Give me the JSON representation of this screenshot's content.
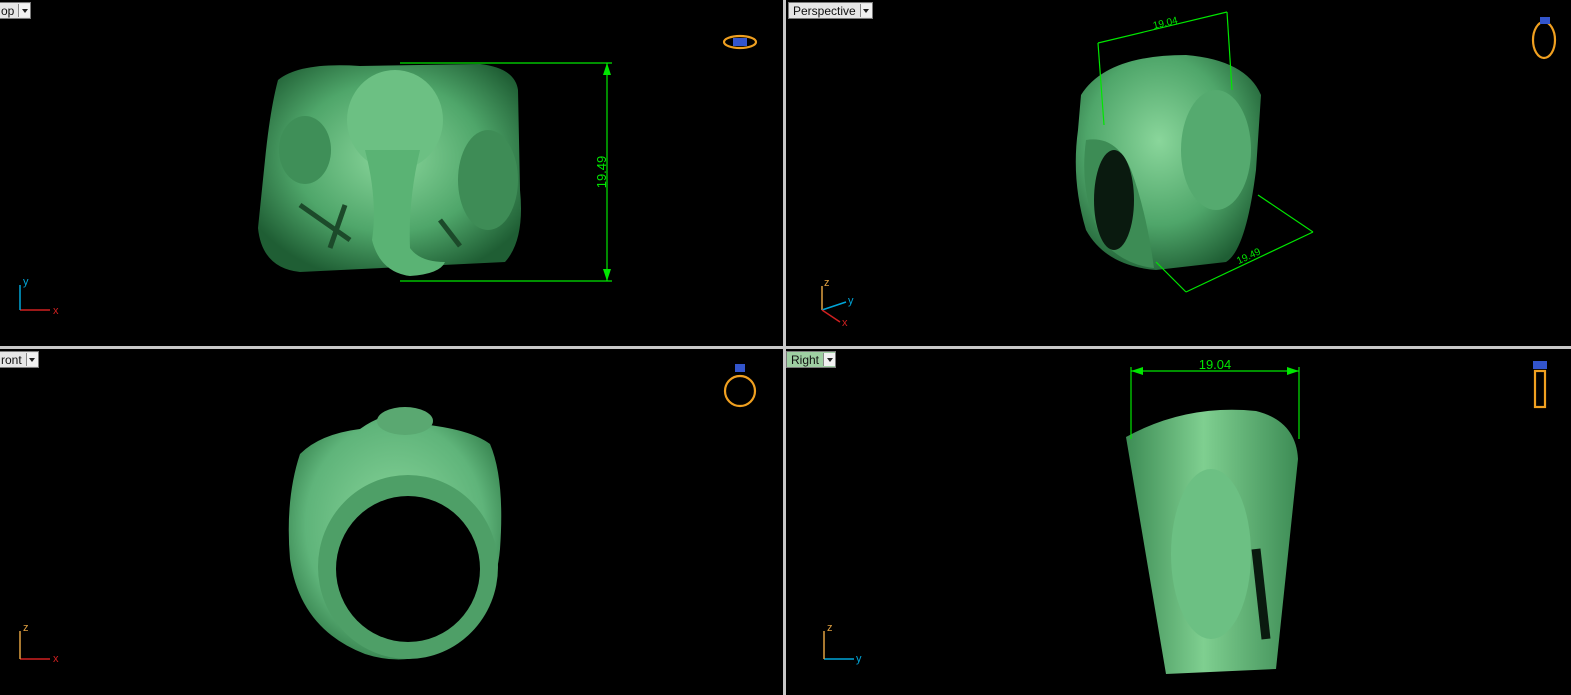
{
  "viewports": {
    "top": {
      "label": "op",
      "dimension": "19.49",
      "axes": {
        "vertical": "y",
        "horizontal": "x"
      }
    },
    "perspective": {
      "label": "Perspective",
      "dimensions": [
        "19.04",
        "19.49"
      ],
      "axes": {
        "vertical": "z",
        "horizontal": "y",
        "depth": "x"
      }
    },
    "front": {
      "label": "ront",
      "axes": {
        "vertical": "z",
        "horizontal": "x"
      }
    },
    "right": {
      "label": "Right",
      "dimension": "19.04",
      "axes": {
        "vertical": "z",
        "horizontal": "y"
      }
    }
  },
  "colors": {
    "model": "#4fa66a",
    "model_light": "#7fcf90",
    "dimension": "#00e600",
    "active_tab": "#9fd0a3",
    "axis_x": "#d02020",
    "axis_y": "#00a5d8",
    "axis_z": "#e0a040",
    "ring_icon": "#f0a020"
  }
}
